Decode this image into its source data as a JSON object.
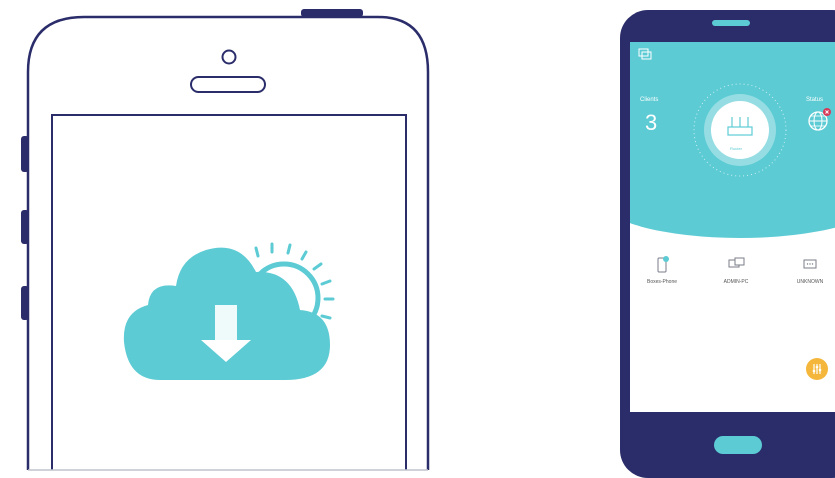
{
  "app": {
    "clients_label": "Clients",
    "clients_count": "3",
    "status_label": "Status",
    "router_label": "Router"
  },
  "devices": [
    {
      "label": "Boxes-Phone",
      "icon": "phone-icon"
    },
    {
      "label": "ADMIN-PC",
      "icon": "computer-icon"
    },
    {
      "label": "UNKNOWN",
      "icon": "unknown-device-icon"
    }
  ],
  "colors": {
    "teal": "#5ccbd4",
    "navy": "#2b2d6b",
    "accent_orange": "#f4b73b",
    "alert_red": "#d63a5a"
  }
}
